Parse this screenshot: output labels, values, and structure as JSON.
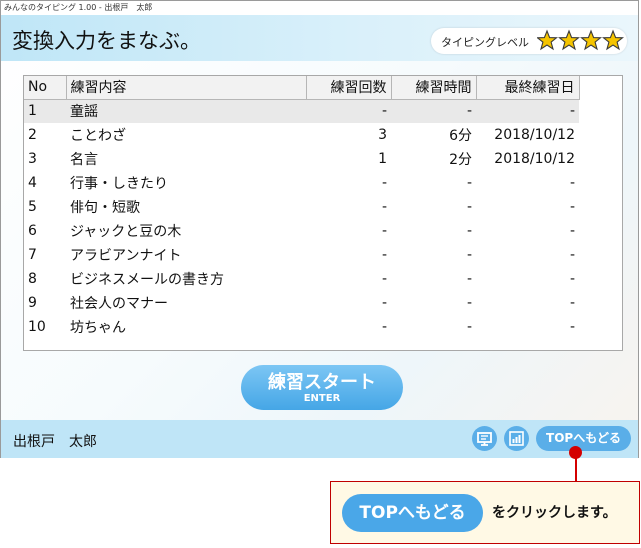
{
  "window": {
    "title": "みんなのタイピング 1.00 - 出根戸　太郎"
  },
  "header": {
    "title": "変換入力をまなぶ。",
    "level_label": "タイピングレベル",
    "stars": 4
  },
  "table": {
    "columns": [
      "No",
      "練習内容",
      "練習回数",
      "練習時間",
      "最終練習日"
    ],
    "rows": [
      {
        "no": "1",
        "content": "童謡",
        "count": "-",
        "time": "-",
        "last": "-"
      },
      {
        "no": "2",
        "content": "ことわざ",
        "count": "3",
        "time": "6分",
        "last": "2018/10/12"
      },
      {
        "no": "3",
        "content": "名言",
        "count": "1",
        "time": "2分",
        "last": "2018/10/12"
      },
      {
        "no": "4",
        "content": "行事・しきたり",
        "count": "-",
        "time": "-",
        "last": "-"
      },
      {
        "no": "5",
        "content": "俳句・短歌",
        "count": "-",
        "time": "-",
        "last": "-"
      },
      {
        "no": "6",
        "content": "ジャックと豆の木",
        "count": "-",
        "time": "-",
        "last": "-"
      },
      {
        "no": "7",
        "content": "アラビアンナイト",
        "count": "-",
        "time": "-",
        "last": "-"
      },
      {
        "no": "8",
        "content": "ビジネスメールの書き方",
        "count": "-",
        "time": "-",
        "last": "-"
      },
      {
        "no": "9",
        "content": "社会人のマナー",
        "count": "-",
        "time": "-",
        "last": "-"
      },
      {
        "no": "10",
        "content": "坊ちゃん",
        "count": "-",
        "time": "-",
        "last": "-"
      }
    ]
  },
  "start_button": {
    "label": "練習スタート",
    "sub": "ENTER"
  },
  "footer": {
    "user_name": "出根戸　太郎",
    "icons": [
      "monitor-icon",
      "chart-icon"
    ],
    "top_button": "TOPへもどる"
  },
  "callout": {
    "button_label": "TOPへもどる",
    "text": "をクリックします。"
  },
  "colors": {
    "accent": "#4aa7e8",
    "header": "#bfe6f7",
    "pointer": "#d40000",
    "star": "#f5c400"
  }
}
